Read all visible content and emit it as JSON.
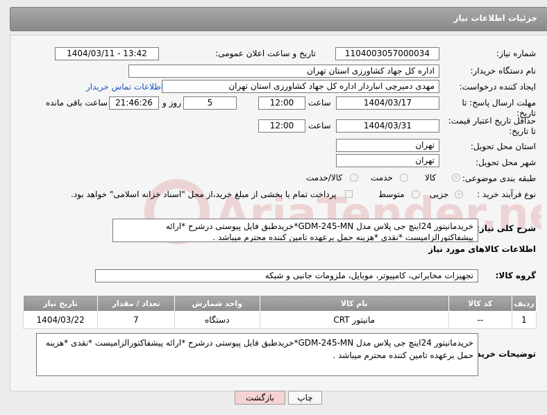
{
  "header": {
    "title": "جزئیات اطلاعات نیاز"
  },
  "labels": {
    "need_number": "شماره نیاز:",
    "announce_datetime": "تاریخ و ساعت اعلان عمومی:",
    "buyer_org": "نام دستگاه خریدار:",
    "requester": "ایجاد کننده درخواست:",
    "reply_deadline": "مهلت ارسال پاسخ: تا تاریخ:",
    "price_validity": "حداقل تاریخ اعتبار قیمت: تا تاریخ:",
    "delivery_province": "استان محل تحویل:",
    "delivery_city": "شهر محل تحویل:",
    "category": "طبقه بندی موضوعی:",
    "process_type": "نوع فرآیند خرید :",
    "time_word": "ساعت",
    "day_word": "روز و",
    "remaining": "ساعت باقی مانده",
    "need_desc": "شرح کلی نیاز:",
    "goods_info": "اطلاعات کالاهای مورد نیاز",
    "goods_group": "گروه کالا:",
    "buyer_notes": "توضیحات خریدار:"
  },
  "fields": {
    "need_number": "1104003057000034",
    "announce_datetime": "1404/03/11 - 13:42",
    "buyer_org": "اداره کل جهاد کشاورزی استان تهران",
    "requester": "مهدی  دمیرچی انباردار اداره کل جهاد کشاورزی استان تهران",
    "contact_link": "اطلاعات تماس خریدار",
    "reply_date": "1404/03/17",
    "reply_time": "12:00",
    "days": "5",
    "remaining_time": "21:46:26",
    "validity_date": "1404/03/31",
    "validity_time": "12:00",
    "province": "تهران",
    "city": "تهران"
  },
  "category_options": [
    {
      "label": "کالا",
      "selected": true
    },
    {
      "label": "خدمت",
      "selected": false
    },
    {
      "label": "کالا/خدمت",
      "selected": false
    }
  ],
  "process_options": [
    {
      "label": "جزیی",
      "selected": true
    },
    {
      "label": "متوسط",
      "selected": false
    }
  ],
  "payment_note": "پرداخت تمام یا بخشی از مبلغ خرید،از محل \"اسناد خزانه اسلامی\" خواهد بود.",
  "need_description": "خریدمانیتور 24اینچ جی پلاس مدل GDM-245-MN*خریدطبق فایل پیوستی درشرح *ارائه پیشفاکتورالزامیست *نقدی *هزینه حمل برعهده تامین کننده محترم میباشد .",
  "goods_group": "تجهیزات مخابراتی، کامپیوتر، موبایل، ملزومات جانبی و شبکه",
  "table": {
    "headers": [
      "ردیف",
      "کد کالا",
      "نام کالا",
      "واحد شمارش",
      "تعداد / مقدار",
      "تاریخ نیاز"
    ],
    "rows": [
      [
        "1",
        "--",
        "مانیتور CRT",
        "دستگاه",
        "7",
        "1404/03/22"
      ]
    ]
  },
  "buyer_notes": "خریدمانیتور 24اینچ جی پلاس مدل GDM-245-MN*خریدطبق فایل پیوستی درشرح *ارائه پیشفاکتورالزامیست *نقدی *هزینه حمل برعهده تامین کننده محترم میباشد .",
  "buttons": {
    "print": "چاپ",
    "back": "بازگشت"
  },
  "watermark_text": "AriaTender.neT",
  "colors": {
    "header": "#999999",
    "link": "#1a56c4",
    "back_button": "#f6d3d3"
  }
}
